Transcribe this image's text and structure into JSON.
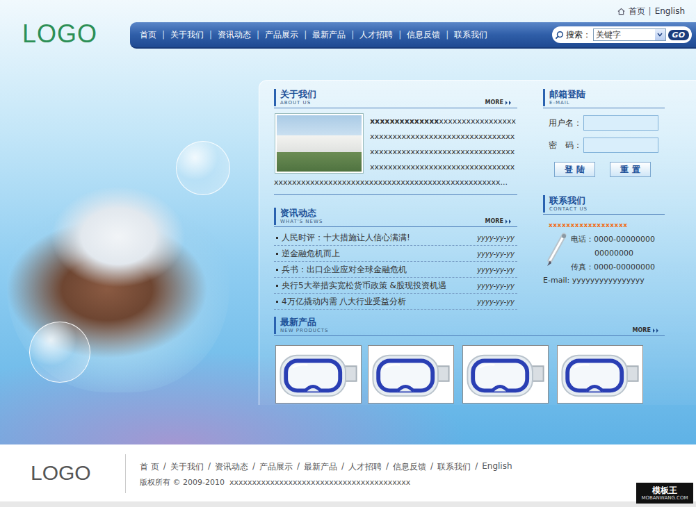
{
  "logo": "LOGO",
  "top_links": {
    "home": "首页",
    "separator": "|",
    "english": "English"
  },
  "nav": {
    "separator": "|",
    "items": [
      {
        "label": "首页"
      },
      {
        "label": "关于我们"
      },
      {
        "label": "资讯动态"
      },
      {
        "label": "产品展示"
      },
      {
        "label": "最新产品"
      },
      {
        "label": "人才招聘"
      },
      {
        "label": "信息反馈"
      },
      {
        "label": "联系我们"
      }
    ]
  },
  "search": {
    "label": "搜索：",
    "select_value": "关键字",
    "button": "GO"
  },
  "about": {
    "title": "关于我们",
    "subtitle": "ABOUT US",
    "more": "MORE",
    "lead": "xxxxxxxxxxxxxx",
    "body": "xxxxxxxxxxxxxxxxxxxxxxxxxxxxxxxxxxxxxxxxxxxxxxxxxxxxxxxxxxxxxxxxxxxxxxxxxxxxxxxxxxxxxxxxxxxxxxxxxxxxxxxxxxxxxxxxxxxxxxxxxxxxxxxxxxxxxxxxxxxxxxxxxxxxxxxxxxxxxxxxxxx..."
  },
  "news": {
    "title": "资讯动态",
    "subtitle": "WHAT'S NEWS",
    "more": "MORE",
    "items": [
      {
        "title": "人民时评：十大措施让人信心满满!",
        "date": "yyyy-yy-yy"
      },
      {
        "title": "逆金融危机而上",
        "date": "yyyy-yy-yy"
      },
      {
        "title": "兵书：出口企业应对全球金融危机",
        "date": "yyyy-yy-yy"
      },
      {
        "title": "央行5大举措实宽松货币政策 &股现投资机遇",
        "date": "yyyy-yy-yy"
      },
      {
        "title": "4万亿撬动内需 八大行业受益分析",
        "date": "yyyy-yy-yy"
      }
    ]
  },
  "products": {
    "title": "最新产品",
    "subtitle": "NEW PRODUCTS",
    "more": "MORE",
    "items": [
      {
        "kind": "goggles"
      },
      {
        "kind": "goggles"
      },
      {
        "kind": "goggles"
      },
      {
        "kind": "goggles"
      }
    ]
  },
  "mail": {
    "title": "邮箱登陆",
    "subtitle": "E-MAIL",
    "fields": [
      {
        "label": "用户名：",
        "value": ""
      },
      {
        "label": "密　码：",
        "value": ""
      }
    ],
    "buttons": [
      "登 陆",
      "重 置"
    ]
  },
  "contact": {
    "title": "联系我们",
    "subtitle": "CONTACT US",
    "tagline": "xxxxxxxxxxxxxxxxxx",
    "phone_label": "电话：",
    "phone": "0000-00000000",
    "phone2": "00000000",
    "fax_label": "传真：",
    "fax": "0000-00000000",
    "email_label": "E-mail:",
    "email": "yyyyyyyyyyyyyyyy"
  },
  "footer": {
    "logo": "LOGO",
    "separator": "/",
    "links": [
      "首 页",
      "关于我们",
      "资讯动态",
      "产品展示",
      "最新产品",
      "人才招聘",
      "信息反馈",
      "联系我们",
      "English"
    ],
    "copyright_label": "版权所有",
    "copyright_symbol": "©",
    "years": "2009-2010",
    "owner": "xxxxxxxxxxxxxxxxxxxxxxxxxxxxxxxxxxxxxxxx"
  },
  "watermark": {
    "name": "模板王",
    "url": "MOBANWANG.COM"
  }
}
